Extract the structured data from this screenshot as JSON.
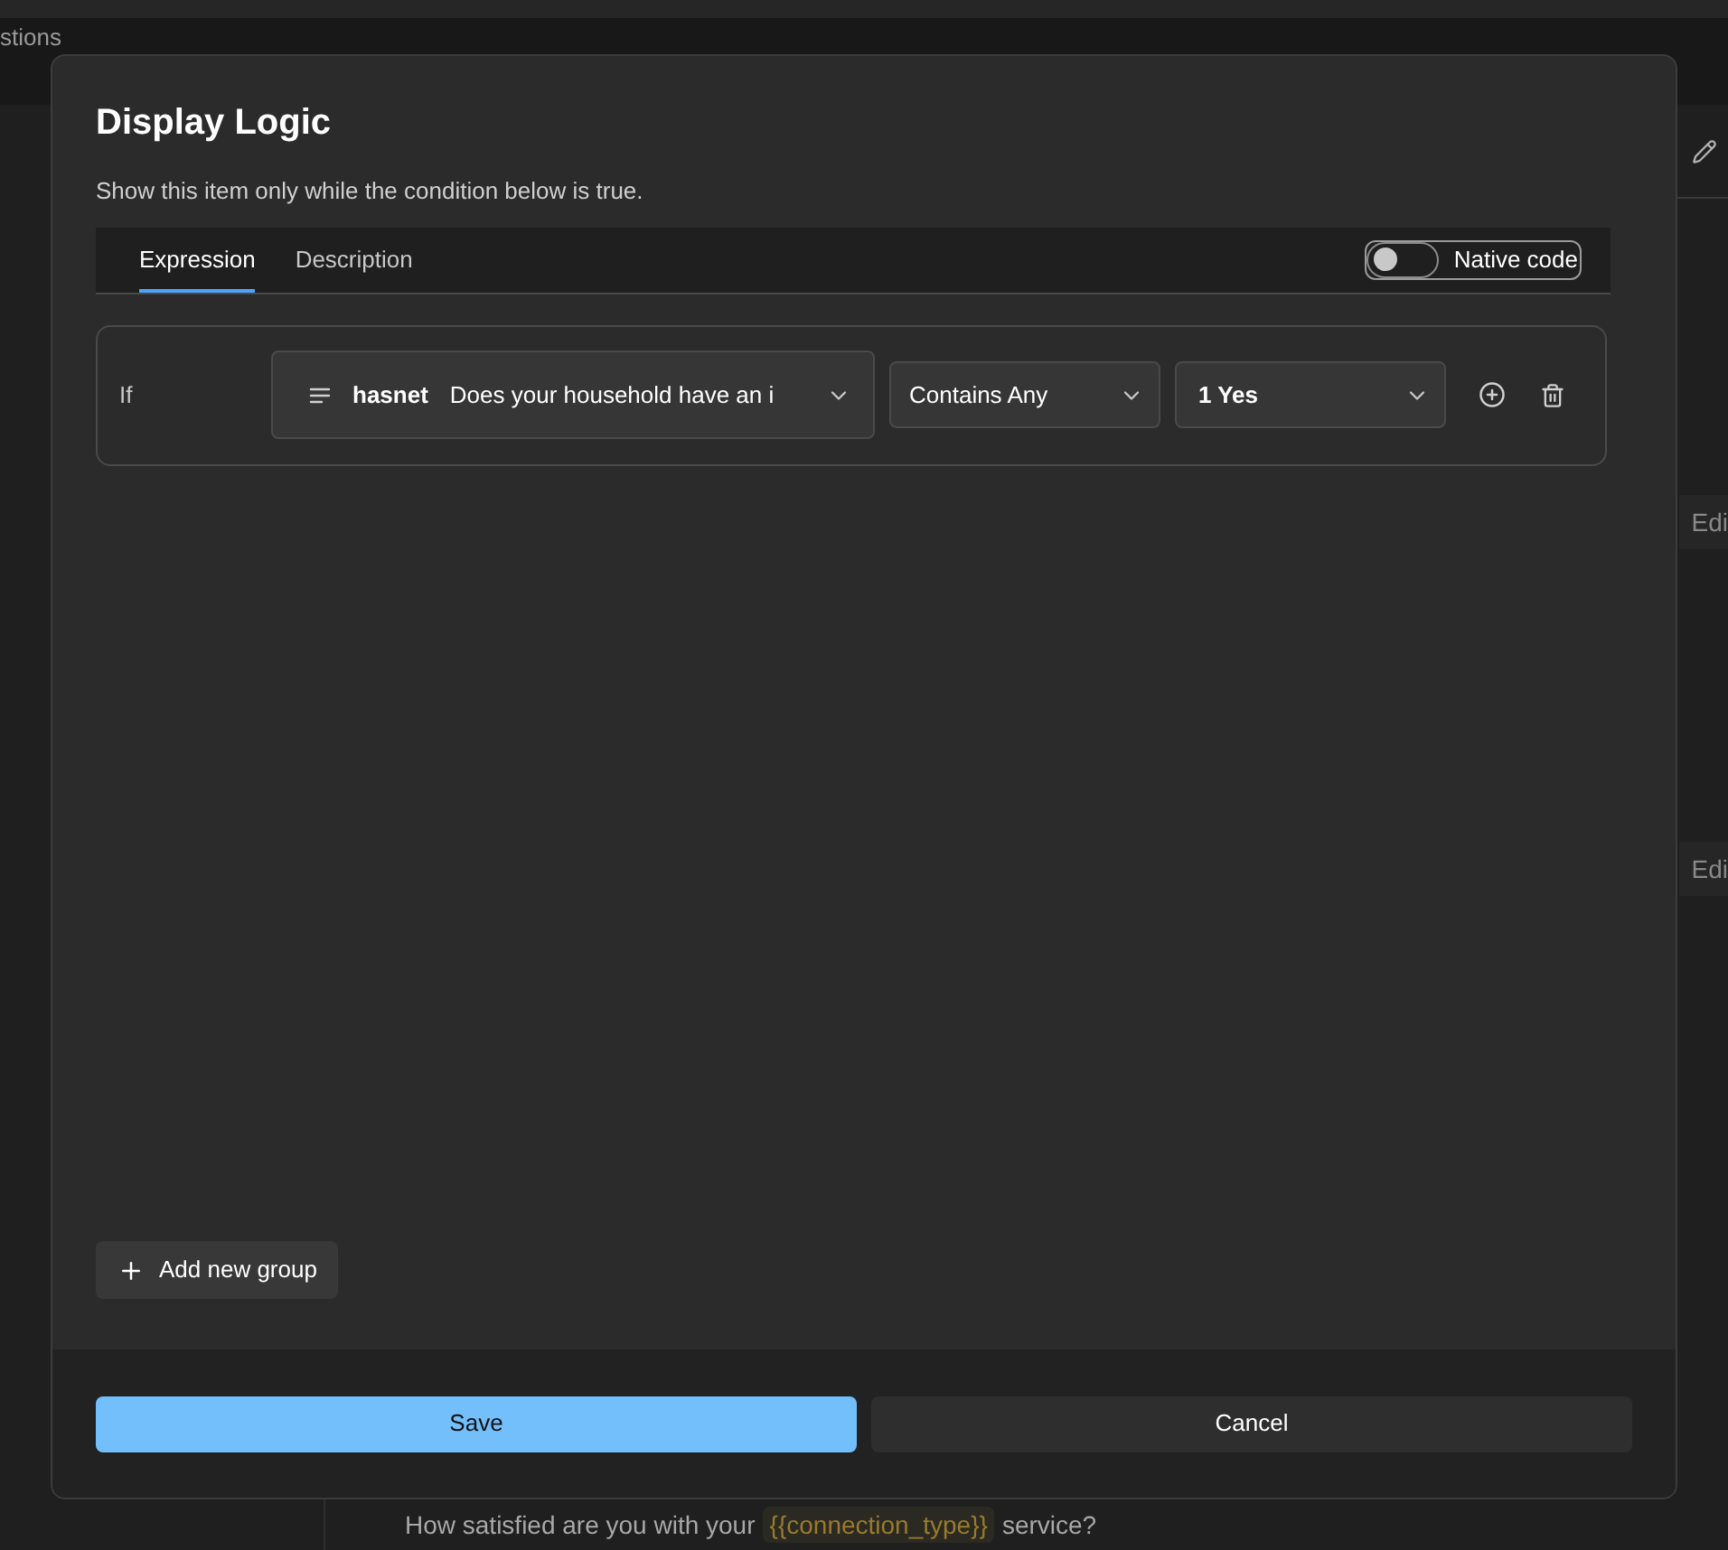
{
  "background": {
    "tab": "stions",
    "edit_buttons": [
      "Edi",
      "Edi"
    ],
    "question": {
      "before": "How satisfied are you with your",
      "variable": "{{connection_type}}",
      "after": "service?"
    }
  },
  "dialog": {
    "title": "Display Logic",
    "subtitle": "Show this item only while the condition below is true.",
    "tabs": [
      {
        "label": "Expression",
        "selected": true
      },
      {
        "label": "Description",
        "selected": false
      }
    ],
    "native_code": {
      "label": "Native code",
      "on": false
    },
    "conditions": [
      {
        "connector": "If",
        "field": {
          "name": "hasnet",
          "text": "Does your household have an i"
        },
        "operator": "Contains Any",
        "value": "1 Yes"
      }
    ],
    "add_group": "Add new group",
    "buttons": [
      {
        "label": "Save",
        "kind": "primary"
      },
      {
        "label": "Cancel",
        "kind": "secondary"
      }
    ]
  }
}
